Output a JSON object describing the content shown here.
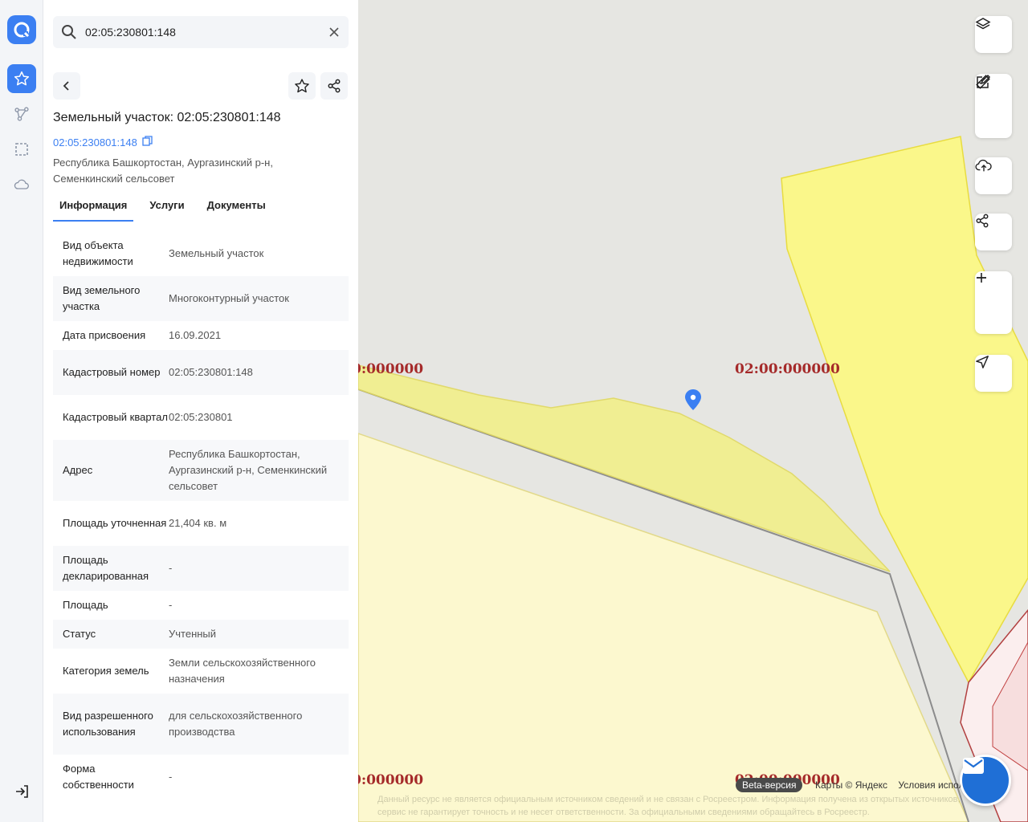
{
  "search": {
    "value": "02:05:230801:148"
  },
  "object": {
    "title": "Земельный участок: 02:05:230801:148",
    "cadastral_link": "02:05:230801:148",
    "address": "Республика Башкортостан, Аургазинский р-н, Семенкинский сельсовет"
  },
  "tabs": [
    {
      "label": "Информация"
    },
    {
      "label": "Услуги"
    },
    {
      "label": "Документы"
    }
  ],
  "rows": [
    {
      "key": "Вид объекта недвижимости",
      "value": "Земельный участок"
    },
    {
      "key": "Вид земельного участка",
      "value": "Многоконтурный участок"
    },
    {
      "key": "Дата присвоения",
      "value": "16.09.2021"
    },
    {
      "key": "Кадастровый номер",
      "value": "02:05:230801:148"
    },
    {
      "key": "Кадастровый квартал",
      "value": "02:05:230801"
    },
    {
      "key": "Адрес",
      "value": "Республика Башкортостан, Аургазинский р-н, Семенкинский сельсовет"
    },
    {
      "key": "Площадь уточненная",
      "value": "21,404 кв. м"
    },
    {
      "key": "Площадь декларированная",
      "value": "-"
    },
    {
      "key": "Площадь",
      "value": "-"
    },
    {
      "key": "Статус",
      "value": "Учтенный"
    },
    {
      "key": "Категория земель",
      "value": "Земли сельскохозяйственного назначения"
    },
    {
      "key": "Вид разрешенного использования",
      "value": "для сельскохозяйственного производства"
    },
    {
      "key": "Форма собственности",
      "value": "-"
    }
  ],
  "map": {
    "labels": [
      "0:000000",
      "02:00:000000",
      "0:000000",
      "02:00:000000"
    ],
    "beta": "Beta-версия",
    "attribution": [
      "Карты © Яндекс",
      "Условия испол"
    ],
    "disclaimer": "Данный ресурс не является официальным источником сведений и не связан с Росреестром. Информация получена из открытых источников, сервис не гарантирует точность и не несет ответственности. За официальными сведениями обращайтесь в Росреестр."
  },
  "colors": {
    "accent": "#3b7ff2",
    "parcel_fill": "#f8f68c",
    "label": "#a52a2a"
  }
}
